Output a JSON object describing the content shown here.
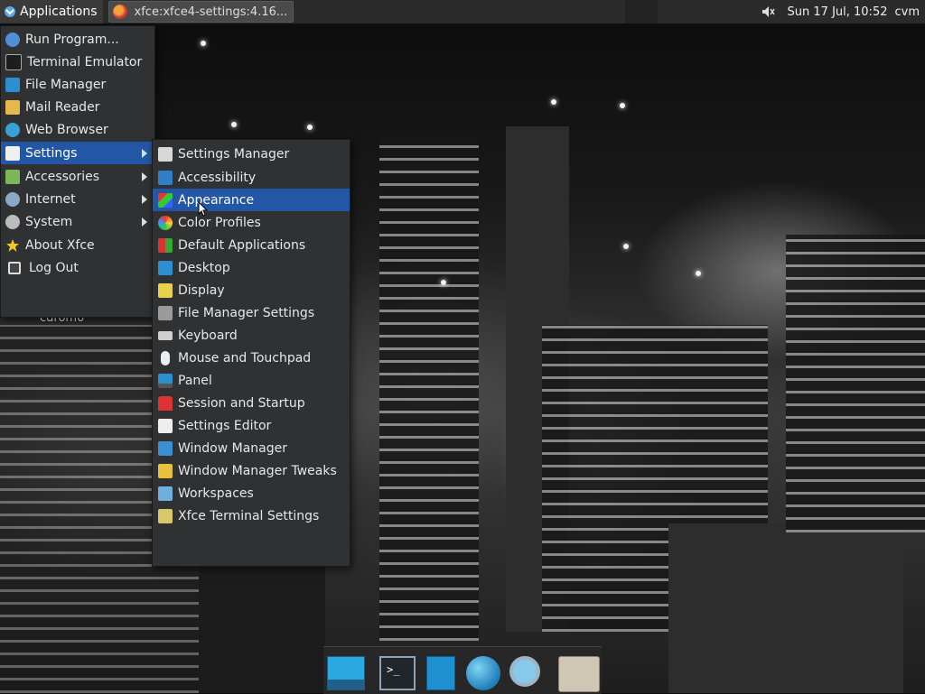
{
  "top_panel": {
    "applications_label": "Applications",
    "task_label": "xfce:xfce4-settings:4.16...",
    "clock": "Sun 17 Jul, 10:52",
    "user": "cvm",
    "volume_icon": "volume-muted-icon"
  },
  "main_menu": {
    "items": [
      {
        "label": "Run Program...",
        "icon": "run-program-icon"
      },
      {
        "label": "Terminal Emulator",
        "icon": "terminal-icon"
      },
      {
        "label": "File Manager",
        "icon": "file-manager-icon"
      },
      {
        "label": "Mail Reader",
        "icon": "mail-icon"
      },
      {
        "label": "Web Browser",
        "icon": "web-browser-icon"
      },
      {
        "label": "Settings",
        "icon": "settings-icon",
        "selected": true,
        "submenu": true
      },
      {
        "label": "Accessories",
        "icon": "accessories-icon",
        "submenu": true
      },
      {
        "label": "Internet",
        "icon": "internet-icon",
        "submenu": true
      },
      {
        "label": "System",
        "icon": "system-gear-icon",
        "submenu": true
      },
      {
        "label": "About Xfce",
        "icon": "star-icon"
      },
      {
        "label": "Log Out",
        "icon": "logout-icon"
      }
    ]
  },
  "settings_menu": {
    "items": [
      {
        "label": "Settings Manager",
        "icon": "settings-manager-icon"
      },
      {
        "label": "Accessibility",
        "icon": "accessibility-icon"
      },
      {
        "label": "Appearance",
        "icon": "appearance-icon",
        "selected": true
      },
      {
        "label": "Color Profiles",
        "icon": "color-profiles-icon"
      },
      {
        "label": "Default Applications",
        "icon": "default-applications-icon"
      },
      {
        "label": "Desktop",
        "icon": "desktop-icon"
      },
      {
        "label": "Display",
        "icon": "display-icon"
      },
      {
        "label": "File Manager Settings",
        "icon": "file-manager-settings-icon"
      },
      {
        "label": "Keyboard",
        "icon": "keyboard-icon"
      },
      {
        "label": "Mouse and Touchpad",
        "icon": "mouse-icon"
      },
      {
        "label": "Panel",
        "icon": "panel-icon"
      },
      {
        "label": "Session and Startup",
        "icon": "session-startup-icon"
      },
      {
        "label": "Settings Editor",
        "icon": "settings-editor-icon"
      },
      {
        "label": "Window Manager",
        "icon": "window-manager-icon"
      },
      {
        "label": "Window Manager Tweaks",
        "icon": "window-manager-tweaks-icon"
      },
      {
        "label": "Workspaces",
        "icon": "workspaces-icon"
      },
      {
        "label": "Xfce Terminal Settings",
        "icon": "terminal-settings-icon"
      }
    ]
  },
  "desktop": {
    "label": "cdrom0"
  },
  "dock": {
    "items": [
      {
        "icon": "show-desktop-icon"
      },
      {
        "icon": "terminal-icon",
        "glyph": ">_"
      },
      {
        "icon": "file-manager-icon"
      },
      {
        "icon": "web-browser-icon"
      },
      {
        "icon": "app-finder-icon"
      },
      {
        "icon": "folder-icon"
      }
    ]
  },
  "colors": {
    "selection": "#2357a5",
    "panel": "#2b2b2b",
    "menu": "#2f3132"
  }
}
